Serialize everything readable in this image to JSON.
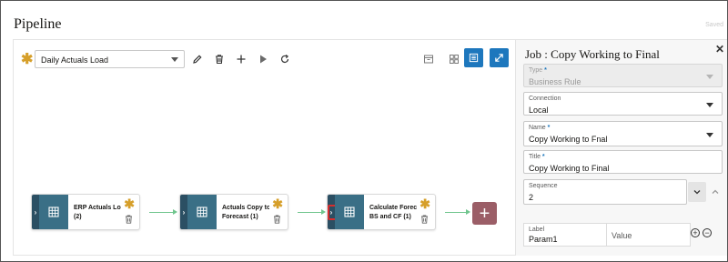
{
  "header": {
    "title": "Pipeline",
    "saved": "Saved"
  },
  "pipeline": {
    "selected": "Daily Actuals Load"
  },
  "nodes": [
    {
      "label_line1": "ERP Actuals Loa",
      "label_line2": "(2)"
    },
    {
      "label_line1": "Actuals Copy to",
      "label_line2": "Forecast (1)"
    },
    {
      "label_line1": "Calculate Forec",
      "label_line2": "BS and CF (1)"
    }
  ],
  "panel": {
    "title": "Job : Copy Working to Final",
    "type_label": "Type",
    "type_value": "Business Rule",
    "connection_label": "Connection",
    "connection_value": "Local",
    "name_label": "Name",
    "name_value": "Copy Working to Fnal",
    "title_label": "Title",
    "title_value": "Copy Working to Final",
    "sequence_label": "Sequence",
    "sequence_value": "2",
    "param_label_header": "Label",
    "param_value_header": "Value",
    "param_label_value": "Param1"
  },
  "colors": {
    "accent": "#1d77bd",
    "node_dark": "#2b4f63",
    "node_icon": "#3a6f86",
    "connector": "#6fc58d",
    "add_node": "#9b5e67",
    "required": "#d69f2a",
    "selection": "#d62e2e"
  }
}
